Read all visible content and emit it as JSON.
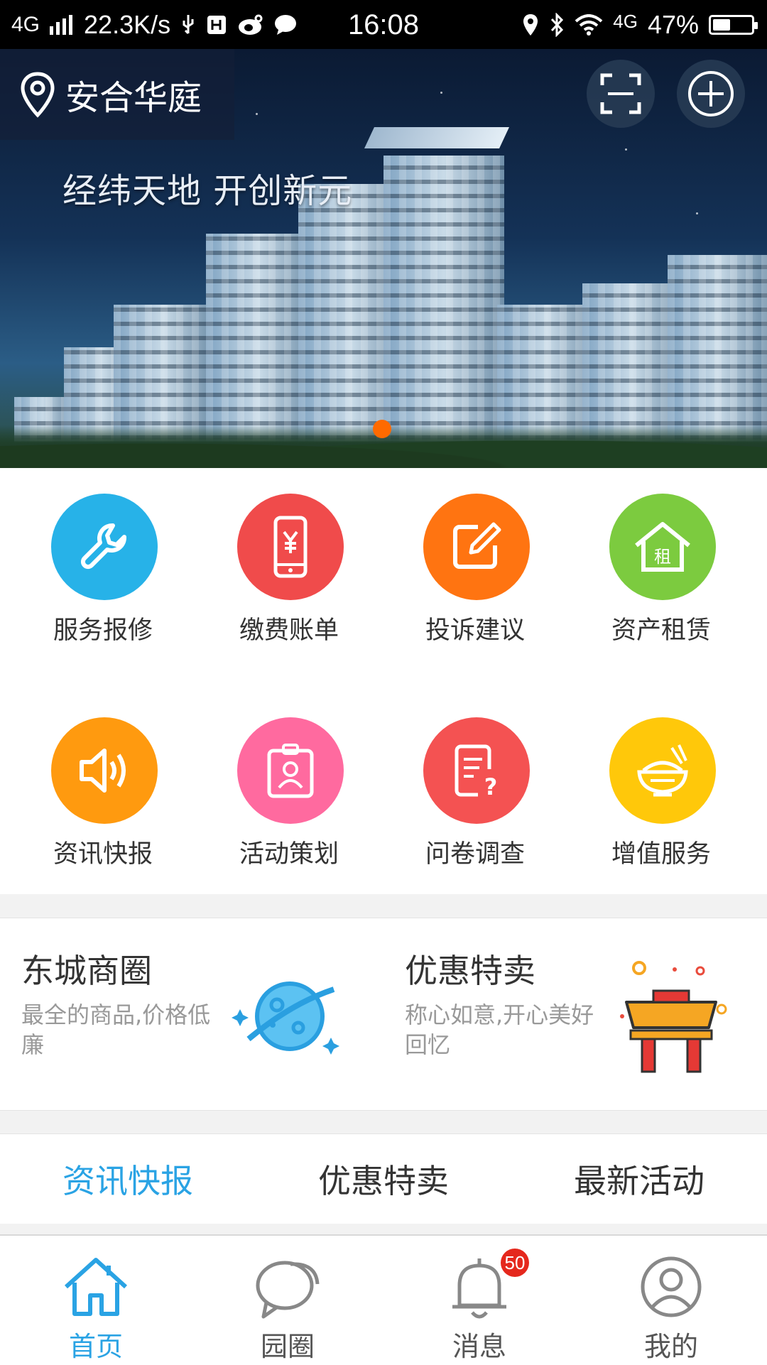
{
  "status_bar": {
    "network": "4G",
    "speed": "22.3K/s",
    "time": "16:08",
    "network2": "4G",
    "battery": "47%",
    "battery_level": 0.47
  },
  "header": {
    "location": "安合华庭",
    "scan_icon": "scan-icon",
    "add_icon": "plus-circle-icon"
  },
  "banner": {
    "slogan": "经纬天地  开创新元",
    "active_dot_color": "#ff6a00"
  },
  "services": [
    {
      "label": "服务报修",
      "icon": "wrench-icon",
      "color": "#27b2e8"
    },
    {
      "label": "缴费账单",
      "icon": "phone-yen-icon",
      "color": "#f04b4b"
    },
    {
      "label": "投诉建议",
      "icon": "edit-icon",
      "color": "#ff7411"
    },
    {
      "label": "资产租赁",
      "icon": "house-rent-icon",
      "color": "#7ccb3f"
    },
    {
      "label": "资讯快报",
      "icon": "speaker-icon",
      "color": "#ff9a0f"
    },
    {
      "label": "活动策划",
      "icon": "badge-person-icon",
      "color": "#ff6a9f"
    },
    {
      "label": "问卷调查",
      "icon": "survey-icon",
      "color": "#f45252"
    },
    {
      "label": "增值服务",
      "icon": "rice-bowl-icon",
      "color": "#ffc80a"
    }
  ],
  "promos": [
    {
      "title": "东城商圈",
      "subtitle": "最全的商品,价格低廉",
      "icon": "planet-icon"
    },
    {
      "title": "优惠特卖",
      "subtitle": "称心如意,开心美好回忆",
      "icon": "torii-gate-icon"
    }
  ],
  "tabs": [
    {
      "label": "资讯快报",
      "active": true
    },
    {
      "label": "优惠特卖",
      "active": false
    },
    {
      "label": "最新活动",
      "active": false
    }
  ],
  "bottom_nav": [
    {
      "label": "首页",
      "icon": "home-icon",
      "active": true
    },
    {
      "label": "园圈",
      "icon": "chat-bubbles-icon",
      "active": false
    },
    {
      "label": "消息",
      "icon": "bell-icon",
      "active": false,
      "badge": "50"
    },
    {
      "label": "我的",
      "icon": "user-icon",
      "active": false
    }
  ],
  "colors": {
    "accent": "#2aa3e4",
    "badge": "#e5281d"
  }
}
